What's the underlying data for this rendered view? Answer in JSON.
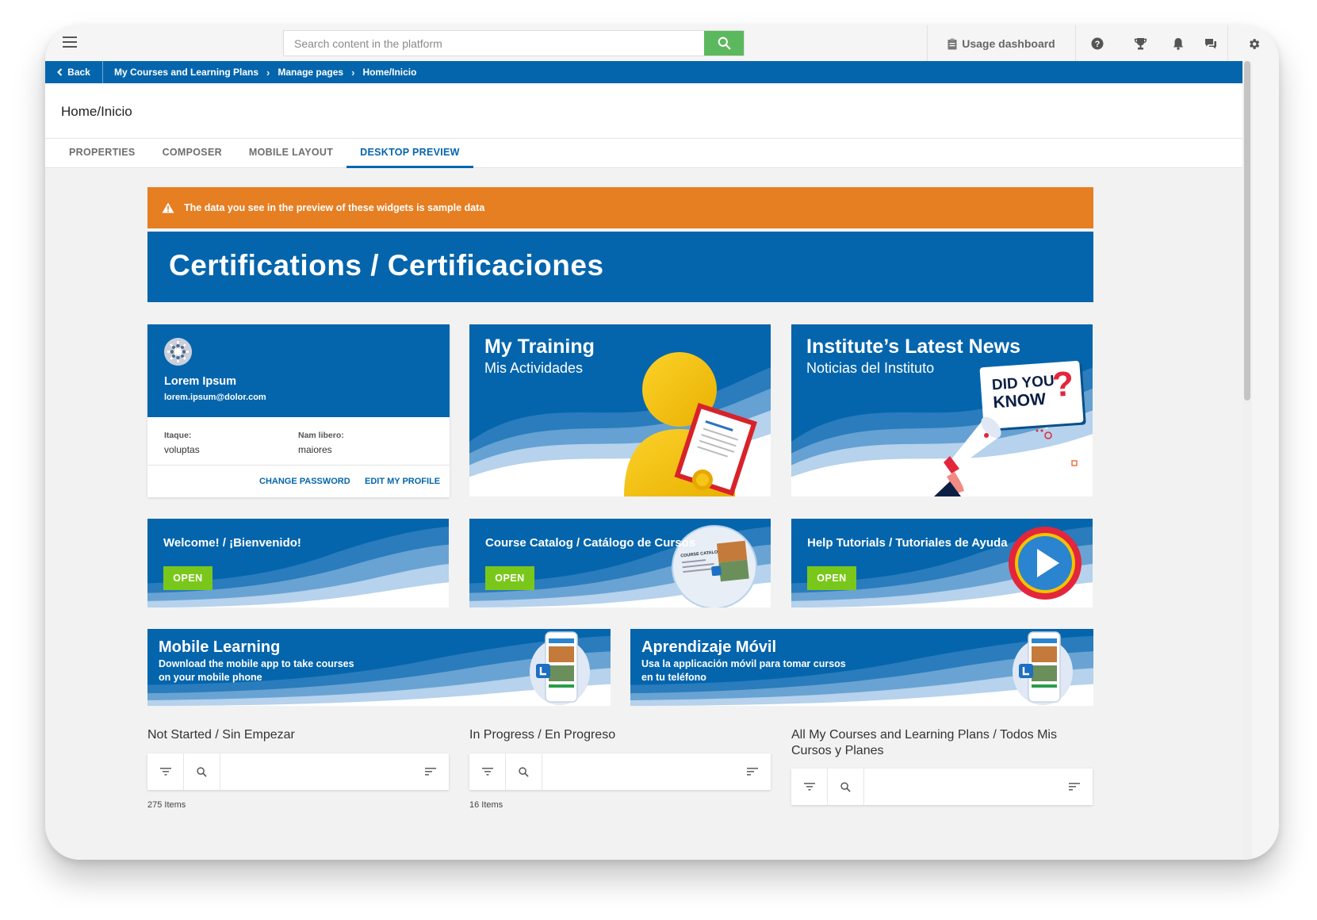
{
  "topbar": {
    "search_placeholder": "Search content in the platform",
    "usage_label": "Usage dashboard",
    "icons": [
      "menu-icon",
      "search-icon",
      "clipboard-icon",
      "help-icon",
      "trophy-icon",
      "bell-icon",
      "chat-icon",
      "gear-icon"
    ]
  },
  "breadcrumb": {
    "back": "Back",
    "items": [
      "My Courses and Learning Plans",
      "Manage pages",
      "Home/Inicio"
    ]
  },
  "page": {
    "title": "Home/Inicio"
  },
  "tabs": [
    {
      "label": "PROPERTIES",
      "active": false
    },
    {
      "label": "COMPOSER",
      "active": false
    },
    {
      "label": "MOBILE LAYOUT",
      "active": false
    },
    {
      "label": "DESKTOP PREVIEW",
      "active": true
    }
  ],
  "warning": {
    "text": "The data you see in the preview of these widgets is sample data"
  },
  "hero": {
    "title": "Certifications / Certificaciones"
  },
  "profile": {
    "name": "Lorem Ipsum",
    "email": "lorem.ipsum@dolor.com",
    "field1_label": "Itaque:",
    "field1_value": "voluptas",
    "field2_label": "Nam libero:",
    "field2_value": "maiores",
    "change_password": "CHANGE PASSWORD",
    "edit_profile": "EDIT MY PROFILE"
  },
  "training": {
    "title": "My Training",
    "subtitle": "Mis Actividades"
  },
  "news": {
    "title": "Institute’s Latest News",
    "subtitle": "Noticias del Instituto",
    "bubble_line1": "DID YOU",
    "bubble_line2": "KNOW",
    "bubble_mark": "?"
  },
  "welcome": {
    "title": "Welcome! / ¡Bienvenido!",
    "button": "OPEN"
  },
  "catalog": {
    "title": "Course Catalog / Catálogo de Cursos",
    "button": "OPEN",
    "thumb_label": "COURSE CATALOG"
  },
  "help": {
    "title": "Help Tutorials / Tutoriales de Ayuda",
    "button": "OPEN"
  },
  "mobile_en": {
    "title": "Mobile Learning",
    "line1": "Download the mobile app to take courses",
    "line2": "on your mobile phone"
  },
  "mobile_es": {
    "title": "Aprendizaje Móvil",
    "line1": "Usa la applicación móvil para tomar cursos",
    "line2": "en tu teléfono"
  },
  "lists": [
    {
      "title": "Not Started / Sin Empezar",
      "count": "275 Items"
    },
    {
      "title": "In Progress / En Progreso",
      "count": "16 Items"
    },
    {
      "title": "All My Courses and Learning Plans / Todos Mis Cursos y Planes",
      "count": ""
    }
  ],
  "colors": {
    "primary": "#0465ac",
    "warning": "#e67e22",
    "open_button": "#7ac71b",
    "search_button": "#5cb85c"
  }
}
